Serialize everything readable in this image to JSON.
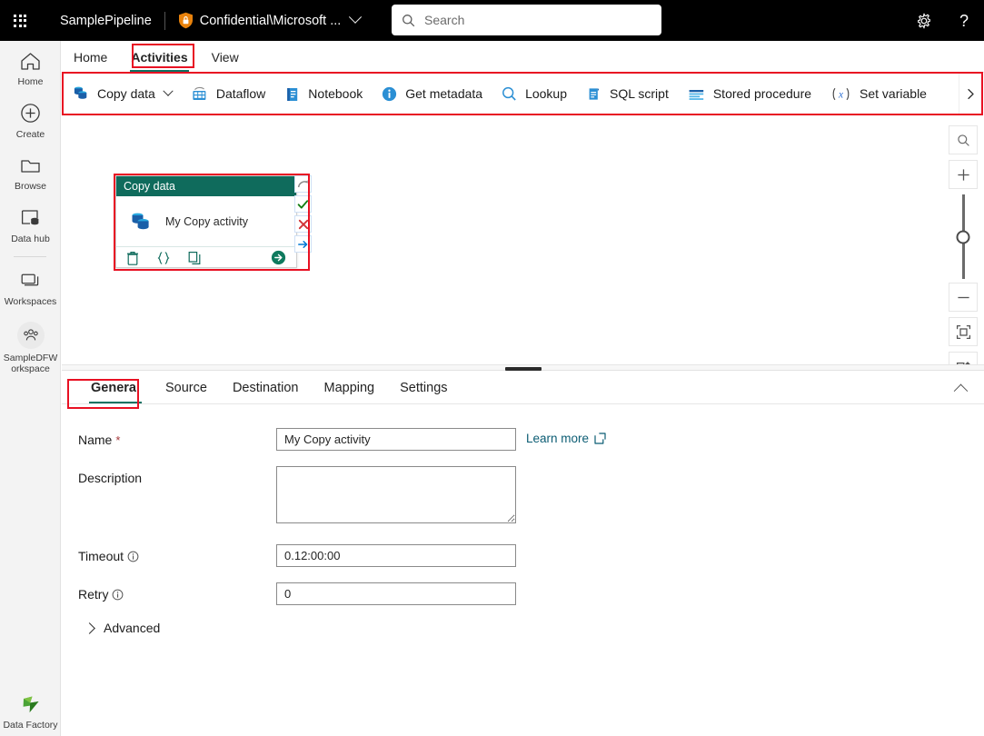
{
  "header": {
    "waffle": "app-launcher",
    "pipeline_name": "SamplePipeline",
    "sensitivity_label": "Confidential\\Microsoft ...",
    "search_placeholder": "Search",
    "settings_icon": "gear-icon",
    "help_icon": "question-mark-icon"
  },
  "sidebar": {
    "items": [
      {
        "label": "Home",
        "icon": "home-icon"
      },
      {
        "label": "Create",
        "icon": "plus-circle-icon"
      },
      {
        "label": "Browse",
        "icon": "folder-icon"
      },
      {
        "label": "Data hub",
        "icon": "data-hub-icon"
      },
      {
        "label": "Workspaces",
        "icon": "workspaces-icon"
      },
      {
        "label": "SampleDFWorkspace",
        "icon": "people-group-icon"
      }
    ],
    "bottom": {
      "label": "Data Factory",
      "icon": "data-factory-icon"
    }
  },
  "ribbon": {
    "tabs": [
      {
        "label": "Home",
        "active": false
      },
      {
        "label": "Activities",
        "active": true
      },
      {
        "label": "View",
        "active": false
      }
    ],
    "activities": [
      {
        "label": "Copy data",
        "icon": "copy-data-icon",
        "has_chevron": true
      },
      {
        "label": "Dataflow",
        "icon": "dataflow-icon",
        "has_chevron": false
      },
      {
        "label": "Notebook",
        "icon": "notebook-icon",
        "has_chevron": false
      },
      {
        "label": "Get metadata",
        "icon": "info-circle-icon",
        "has_chevron": false
      },
      {
        "label": "Lookup",
        "icon": "magnifier-icon",
        "has_chevron": false
      },
      {
        "label": "SQL script",
        "icon": "sql-script-icon",
        "has_chevron": false
      },
      {
        "label": "Stored procedure",
        "icon": "stored-procedure-icon",
        "has_chevron": false
      },
      {
        "label": "Set variable",
        "icon": "set-variable-icon",
        "has_chevron": false
      }
    ],
    "overflow": "chevron-right-icon"
  },
  "canvas": {
    "activity_card": {
      "header_title": "Copy data",
      "activity_name": "My Copy activity",
      "icon": "copy-data-icon",
      "footer_actions": [
        {
          "name": "delete",
          "icon": "trash-icon"
        },
        {
          "name": "code",
          "icon": "braces-icon"
        },
        {
          "name": "duplicate",
          "icon": "copy-icon"
        },
        {
          "name": "run",
          "icon": "green-arrow-circle-icon"
        }
      ],
      "connectors": [
        {
          "name": "skipped",
          "icon": "curved-arrow-icon",
          "color": "#8a8a8a"
        },
        {
          "name": "on-success",
          "icon": "checkmark-icon",
          "color": "#107c10"
        },
        {
          "name": "on-failure",
          "icon": "cross-icon",
          "color": "#d13438"
        },
        {
          "name": "on-completion",
          "icon": "arrow-right-icon",
          "color": "#0078d4"
        }
      ]
    },
    "tools": [
      {
        "name": "zoom-search",
        "icon": "magnifier-icon"
      },
      {
        "name": "zoom-in",
        "icon": "plus-icon"
      },
      {
        "name": "zoom-slider",
        "icon": "slider-handle-icon"
      },
      {
        "name": "zoom-out",
        "icon": "minus-icon"
      },
      {
        "name": "fit-to-screen",
        "icon": "fit-screen-icon"
      },
      {
        "name": "auto-align",
        "icon": "align-icon"
      }
    ]
  },
  "properties": {
    "tabs": [
      {
        "label": "General",
        "active": true
      },
      {
        "label": "Source",
        "active": false
      },
      {
        "label": "Destination",
        "active": false
      },
      {
        "label": "Mapping",
        "active": false
      },
      {
        "label": "Settings",
        "active": false
      }
    ],
    "collapse_icon": "chevron-up-icon",
    "fields": {
      "name_label": "Name",
      "name_required": "*",
      "name_value": "My Copy activity",
      "learn_more": "Learn more",
      "learn_more_icon": "external-link-icon",
      "description_label": "Description",
      "description_value": "",
      "timeout_label": "Timeout",
      "timeout_value": "0.12:00:00",
      "retry_label": "Retry",
      "retry_value": "0",
      "advanced_label": "Advanced",
      "info_icon": "info-icon"
    }
  },
  "colors": {
    "accent_teal": "#0f7162",
    "card_header": "#0f6b5c",
    "highlight_red": "#e81123",
    "link_blue": "#0b5c73"
  }
}
